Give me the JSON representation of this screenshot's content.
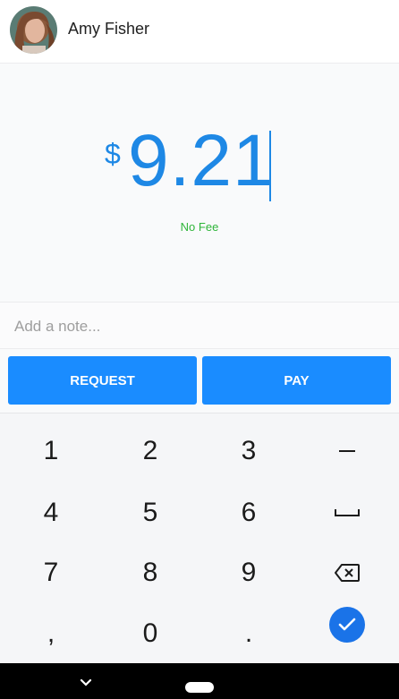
{
  "contact": {
    "name": "Amy Fisher"
  },
  "payment": {
    "currency_symbol": "$",
    "amount": "9.21",
    "fee_text": "No Fee"
  },
  "note": {
    "placeholder": "Add a note..."
  },
  "actions": {
    "request_label": "REQUEST",
    "pay_label": "PAY"
  },
  "keypad": {
    "keys": [
      "1",
      "2",
      "3",
      "4",
      "5",
      "6",
      "7",
      "8",
      "9",
      ",",
      "0",
      "."
    ],
    "special_icons": [
      "minus-icon",
      "space-icon",
      "backspace-icon",
      "checkmark-icon"
    ]
  },
  "colors": {
    "accent": "#1a8cff",
    "amount": "#1e88e5",
    "fee": "#2fb53a",
    "confirm": "#1a73e8"
  },
  "navbar": {
    "icons": [
      "chevron-down-icon",
      "home-pill-icon"
    ]
  }
}
